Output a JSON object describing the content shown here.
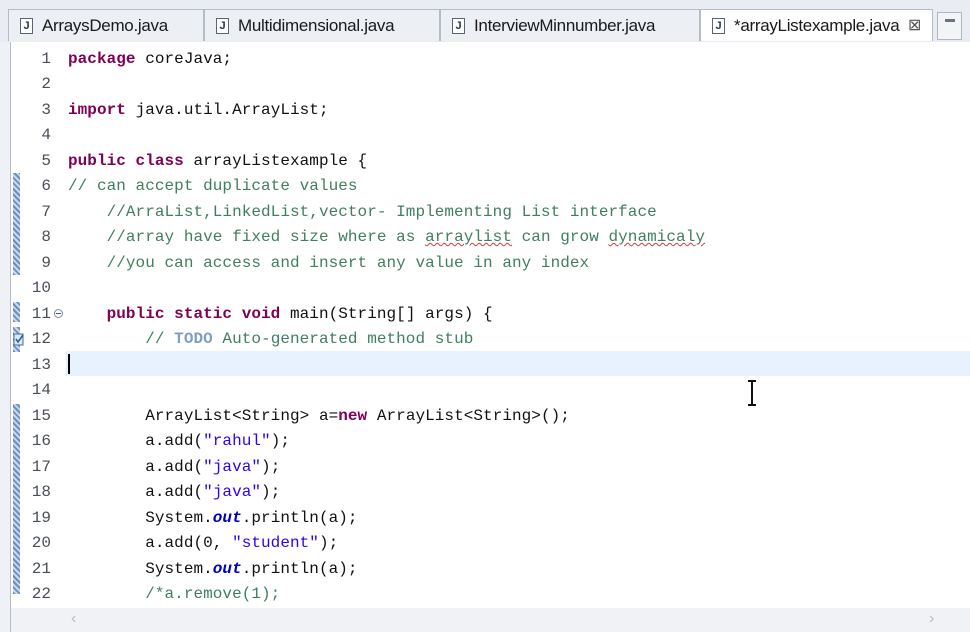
{
  "tabs": [
    {
      "label": "ArraysDemo.java",
      "icon": "java-file-icon",
      "active": false
    },
    {
      "label": "Multidimensional.java",
      "icon": "java-file-icon",
      "active": false
    },
    {
      "label": "InterviewMinnumber.java",
      "icon": "java-file-icon",
      "active": false
    },
    {
      "label": "*arrayListexample.java",
      "icon": "java-file-icon",
      "active": true
    }
  ],
  "file_icon_letter": "J",
  "close_glyph": "⊠",
  "editor": {
    "current_line": 13,
    "lines": [
      {
        "n": "1"
      },
      {
        "n": "2"
      },
      {
        "n": "3"
      },
      {
        "n": "4"
      },
      {
        "n": "5"
      },
      {
        "n": "6"
      },
      {
        "n": "7"
      },
      {
        "n": "8"
      },
      {
        "n": "9"
      },
      {
        "n": "10"
      },
      {
        "n": "11"
      },
      {
        "n": "12"
      },
      {
        "n": "13"
      },
      {
        "n": "14"
      },
      {
        "n": "15"
      },
      {
        "n": "16"
      },
      {
        "n": "17"
      },
      {
        "n": "18"
      },
      {
        "n": "19"
      },
      {
        "n": "20"
      },
      {
        "n": "21"
      },
      {
        "n": "22"
      }
    ],
    "code": {
      "l1_kw": "package",
      "l1_rest": " coreJava;",
      "l3_kw": "import",
      "l3_rest": " java.util.ArrayList;",
      "l5_kw": "public class",
      "l5_rest": " arrayListexample {",
      "l6": "// can accept duplicate values",
      "l7": "    //ArraList,LinkedList,vector- Implementing List interface",
      "l8_a": "    //array have fixed size where as ",
      "l8_sq1": "arraylist",
      "l8_b": " can grow ",
      "l8_sq2": "dynamicaly",
      "l9": "    //you can access and insert any value in any index",
      "l11_ind": "    ",
      "l11_kw": "public static void",
      "l11_rest": " main(String[] args) {",
      "l12_a": "        // ",
      "l12_todo": "TODO",
      "l12_b": " Auto-generated method stub",
      "l15_a": "        ArrayList<String> a=",
      "l15_kw": "new",
      "l15_b": " ArrayList<String>();",
      "l16_a": "        a.add(",
      "l16_s": "\"rahul\"",
      "l16_b": ");",
      "l17_a": "        a.add(",
      "l17_s": "\"java\"",
      "l17_b": ");",
      "l18_a": "        a.add(",
      "l18_s": "\"java\"",
      "l18_b": ");",
      "l19_a": "        System.",
      "l19_f": "out",
      "l19_b": ".println(a);",
      "l20_a": "        a.add(0, ",
      "l20_s": "\"student\"",
      "l20_b": ");",
      "l21_a": "        System.",
      "l21_f": "out",
      "l21_b": ".println(a);",
      "l22": "        /*a.remove(1);"
    }
  },
  "scroll_left_glyph": "‹",
  "scroll_right_glyph": "›"
}
